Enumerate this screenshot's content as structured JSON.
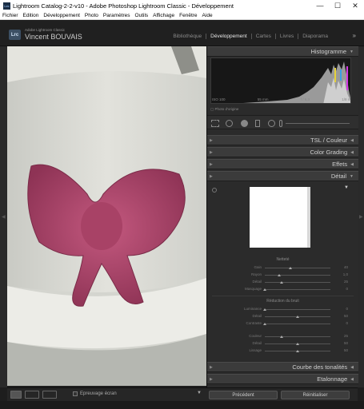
{
  "window": {
    "title": "Lightroom Catalog-2-2-v10 - Adobe Photoshop Lightroom Classic - Développement",
    "app_icon": "Lrc",
    "controls": {
      "minimize": "—",
      "maximize": "☐",
      "close": "✕"
    }
  },
  "menubar": {
    "items": [
      "Fichier",
      "Edition",
      "Développement",
      "Photo",
      "Paramètres",
      "Outils",
      "Affichage",
      "Fenêtre",
      "Aide"
    ]
  },
  "identity": {
    "logo": "Lrc",
    "product": "Adobe Lightroom Classic",
    "user": "Vincent BOUVAIS"
  },
  "modules": {
    "items": [
      "Bibliothèque",
      "Développement",
      "Cartes",
      "Livres",
      "Diaporama"
    ],
    "active": "Développement",
    "expander": "»"
  },
  "right_panel": {
    "histogram": {
      "title": "Histogramme",
      "iso": "ISO 100",
      "focal": "55 mm",
      "aperture": "f / 6,3",
      "shutter": "1/8 s",
      "original_photo_label": "Photo d'origine"
    },
    "collapsed_panels": [
      "TSL / Couleur",
      "Color Grading",
      "Effets"
    ],
    "detail": {
      "title": "Détail",
      "sharpen_title": "Netteté",
      "sharpen_sliders": [
        {
          "label": "Gain",
          "value": "40"
        },
        {
          "label": "Rayon",
          "value": "1,0"
        },
        {
          "label": "Détail",
          "value": "25"
        },
        {
          "label": "Masquage",
          "value": "0"
        }
      ],
      "noise_title": "Réduction du bruit",
      "noise_sliders": [
        {
          "label": "Luminance",
          "value": "0"
        },
        {
          "label": "Détail",
          "value": "50"
        },
        {
          "label": "Contraste",
          "value": "0"
        }
      ],
      "color_sliders": [
        {
          "label": "Couleur",
          "value": "25"
        },
        {
          "label": "Détail",
          "value": "50"
        },
        {
          "label": "Lissage",
          "value": "50"
        }
      ]
    },
    "bottom_panels": [
      "Courbe des tonalités",
      "Etalonnage"
    ],
    "buttons": {
      "previous": "Précédent",
      "reset": "Réinitialiser"
    }
  },
  "toolbar": {
    "softproof_label": "Epreuvage écran"
  },
  "colors": {
    "panel_bg": "#2b2b2b",
    "header_bg": "#3b3b3b",
    "bow": "#b54a70"
  }
}
